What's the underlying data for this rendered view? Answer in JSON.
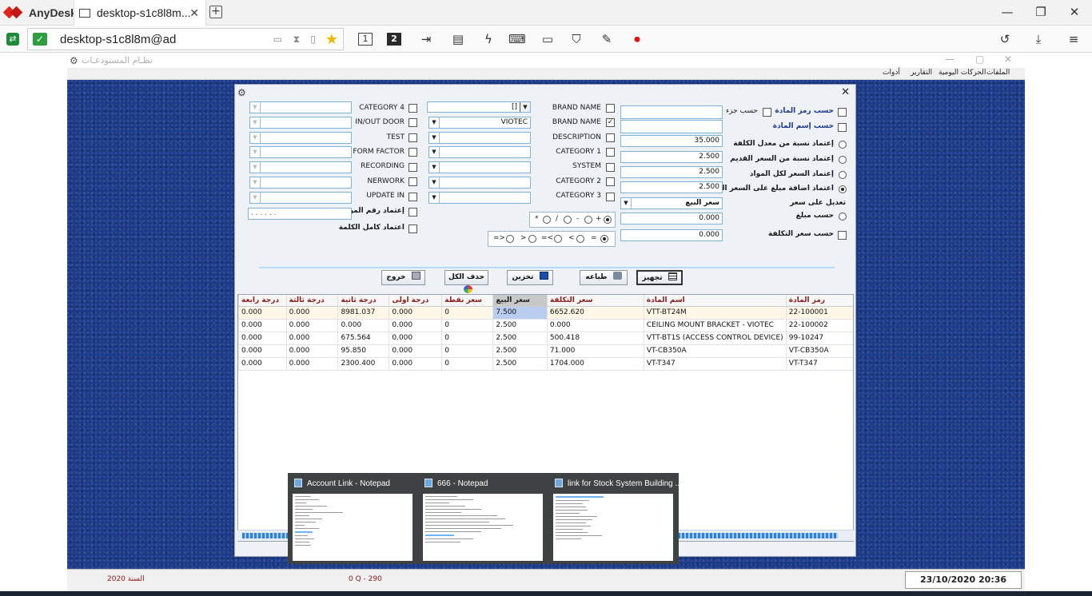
{
  "anydesk": {
    "brand": "AnyDesk",
    "tab_title": "desktop-s1c8l8m...",
    "address": "desktop-s1c8l8m@ad",
    "monitors": [
      "1",
      "2"
    ]
  },
  "app": {
    "title": "نظـام المستودعـات",
    "menu": [
      "الملفات",
      "الحركات اليومية",
      "التقارير",
      "أدوات"
    ],
    "status": {
      "year": "السنة 2020",
      "code": "0 Q - 290",
      "datetime": "23/10/2020 20:36"
    }
  },
  "dialog": {
    "right_options": {
      "by_item_code": "حسب رمز المادة",
      "by_part": "حسب جزء",
      "by_item_name": "حسب إسم المادة",
      "radio_cost_ratio": "إعتماد نسبة من معدل الكلفة",
      "radio_old_price_ratio": "إعتماد نسبة من السعر القديم",
      "radio_price_all": "إعتماد السعر لكل المواد",
      "radio_add_amount": "اعتماد اضافة مبلغ على السعر القديم",
      "modify_on_price": "تعديل على سعر",
      "radio_by_amount": "حسب مبلغ",
      "by_cost_price": "حسب سعر التكلفة",
      "selected_radio": "radio_add_amount"
    },
    "values": {
      "v1": "",
      "v2": "",
      "v3": "35.000",
      "v4": "2.500",
      "v5": "2.500",
      "v6": "2.500",
      "price_select": "سعر البيع",
      "v7": "0.000",
      "v8": "0.000"
    },
    "middle_fields": [
      {
        "label": "BRAND NAME",
        "checked": false,
        "value": "[]",
        "has_arrow": true
      },
      {
        "label": "BRAND NAME",
        "checked": true,
        "value": "VIOTEC",
        "has_arrow": true
      },
      {
        "label": "DESCRIPTION",
        "checked": false,
        "value": "",
        "has_arrow": true
      },
      {
        "label": "CATEGORY 1",
        "checked": false,
        "value": "",
        "has_arrow": true
      },
      {
        "label": "SYSTEM",
        "checked": false,
        "value": "",
        "has_arrow": true
      },
      {
        "label": "CATEGORY 2",
        "checked": false,
        "value": "",
        "has_arrow": true
      },
      {
        "label": "CATEGORY 3",
        "checked": false,
        "value": "",
        "has_arrow": true
      }
    ],
    "left_fields": [
      {
        "label": "CATEGORY 4",
        "value": ""
      },
      {
        "label": "IN/OUT DOOR",
        "value": ""
      },
      {
        "label": "TEST",
        "value": ""
      },
      {
        "label": "FORM FACTOR",
        "value": ""
      },
      {
        "label": "RECORDING",
        "value": ""
      },
      {
        "label": "NERWORK",
        "value": ""
      },
      {
        "label": "UPDATE IN",
        "value": ""
      }
    ],
    "supplier_no_label": "إعتماد رقم المورد",
    "supplier_mask": ". . . .     . .",
    "whole_word_label": "اعتماد كامل الكلمة",
    "ops1": [
      "+",
      "-",
      "/",
      "*"
    ],
    "ops2": [
      "=",
      "<",
      "=<",
      ">",
      "=>"
    ],
    "buttons": {
      "prepare": "تجهيز",
      "print": "طباعه",
      "save": "تخزين",
      "delete_all": "حذف الكل",
      "exit": "خروج"
    },
    "table": {
      "columns": [
        "رمز المادة",
        "اسم المادة",
        "سعر التكلفة",
        "سعر البيع",
        "سعر نقطة",
        "درجة اولى",
        "درجة ثانية",
        "درجة ثالثة",
        "درجة رابعة"
      ],
      "rows": [
        [
          "22-100001",
          "VTT-BT24M",
          "6652.620",
          "7.500",
          "0",
          "0.000",
          "8981.037",
          "0.000",
          "0.000"
        ],
        [
          "22-100002",
          "CEILING MOUNT BRACKET  - VIOTEC",
          "0.000",
          "2.500",
          "0",
          "0.000",
          "0.000",
          "0.000",
          "0.000"
        ],
        [
          "99-10247",
          "VTT-BT1S (ACCESS CONTROL DEVICE)",
          "500.418",
          "2.500",
          "0",
          "0.000",
          "675.564",
          "0.000",
          "0.000"
        ],
        [
          "VT-CB350A",
          "VT-CB350A",
          "71.000",
          "2.500",
          "0",
          "0.000",
          "95.850",
          "0.000",
          "0.000"
        ],
        [
          "VT-T347",
          "VT-T347",
          "1704.000",
          "2.500",
          "0",
          "0.000",
          "2300.400",
          "0.000",
          "0.000"
        ]
      ]
    }
  },
  "thumbnails": [
    {
      "title": "Account Link - Notepad"
    },
    {
      "title": "666 - Notepad"
    },
    {
      "title": "link for Stock System Building ..."
    }
  ]
}
